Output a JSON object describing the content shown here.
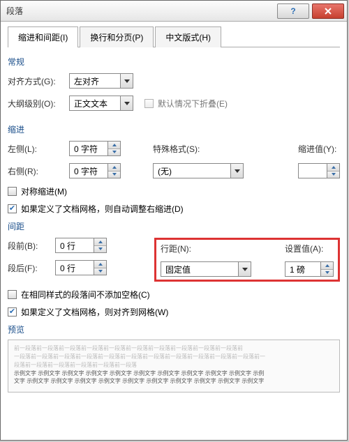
{
  "title": "段落",
  "tabs": {
    "indent": "缩进和间距(I)",
    "pagination": "换行和分页(P)",
    "asian": "中文版式(H)"
  },
  "general": {
    "title": "常规",
    "alignment_label": "对齐方式(G):",
    "alignment_value": "左对齐",
    "outline_label": "大纲级别(O):",
    "outline_value": "正文文本",
    "collapse_label": "默认情况下折叠(E)"
  },
  "indent": {
    "title": "缩进",
    "left_label": "左侧(L):",
    "left_value": "0 字符",
    "right_label": "右侧(R):",
    "right_value": "0 字符",
    "special_label": "特殊格式(S):",
    "special_value": "(无)",
    "by_label": "缩进值(Y):",
    "by_value": "",
    "mirror_label": "对称缩进(M)",
    "grid_label": "如果定义了文档网格，则自动调整右缩进(D)"
  },
  "spacing": {
    "title": "间距",
    "before_label": "段前(B):",
    "before_value": "0 行",
    "after_label": "段后(F):",
    "after_value": "0 行",
    "line_label": "行距(N):",
    "line_value": "固定值",
    "at_label": "设置值(A):",
    "at_value": "1 磅",
    "nospace_label": "在相同样式的段落间不添加空格(C)",
    "snap_label": "如果定义了文档网格，则对齐到网格(W)"
  },
  "preview": {
    "title": "预览",
    "para1": "前一段落前一段落前一段落前一段落前一段落前一段落前一段落前一段落前一段落前一段落前",
    "para2": "一段落前一段落前一段落前一段落前一段落前一段落前一段落前一段落前一段落前一段落前一段落前一",
    "para3": "段落前一段落前一段落前一段落前一段落前一段落",
    "sample1": "示例文字 示例文字 示例文字 示例文字 示例文字 示例文字 示例文字 示例文字 示例文字 示例文字 示例",
    "sample2": "文字 示例文字 示例文字 示例文字 示例文字 示例文字 示例文字 示例文字 示例文字 示例文字 示例文字"
  }
}
